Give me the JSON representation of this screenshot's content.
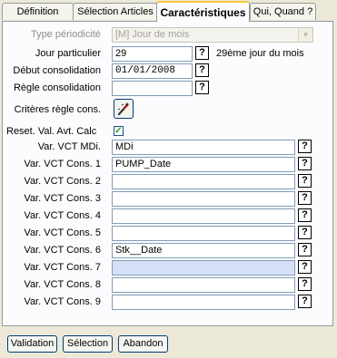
{
  "tabs": [
    {
      "label": "Définition"
    },
    {
      "label": "Sélection Articles"
    },
    {
      "label": "Caractéristiques"
    },
    {
      "label": "Qui, Quand ?"
    }
  ],
  "active_tab": "Caractéristiques",
  "form": {
    "type_periodicite": {
      "label": "Type périodicité",
      "value": "[M] Jour de mois"
    },
    "jour_particulier": {
      "label": "Jour particulier",
      "value": "29",
      "note": "29ème jour du mois"
    },
    "debut_consolidation": {
      "label": "Début consolidation",
      "value": "01/01/2008"
    },
    "regle_consolidation": {
      "label": "Règle consolidation",
      "value": ""
    },
    "criteres_regle": {
      "label": "Critères règle cons."
    },
    "reset_val": {
      "label": "Reset. Val. Avt. Calc",
      "checked": true
    },
    "var_vct": [
      {
        "label": "Var. VCT MDi.",
        "value": "MDi"
      },
      {
        "label": "Var. VCT Cons. 1",
        "value": "PUMP_Date"
      },
      {
        "label": "Var. VCT Cons. 2",
        "value": ""
      },
      {
        "label": "Var. VCT Cons. 3",
        "value": ""
      },
      {
        "label": "Var. VCT Cons. 4",
        "value": ""
      },
      {
        "label": "Var. VCT Cons. 5",
        "value": ""
      },
      {
        "label": "Var. VCT Cons. 6",
        "value": "Stk__Date"
      },
      {
        "label": "Var. VCT Cons. 7",
        "value": ""
      },
      {
        "label": "Var. VCT Cons. 8",
        "value": ""
      },
      {
        "label": "Var. VCT Cons. 9",
        "value": ""
      }
    ]
  },
  "help_glyph": "?",
  "check_glyph": "✓",
  "buttons": {
    "validation": "Validation",
    "selection": "Sélection",
    "abandon": "Abandon"
  },
  "colors": {
    "background": "#ece9d8",
    "panel": "#fcfcfe",
    "active_tab_accent": "#ffc83c",
    "field_border": "#7f9db9",
    "focused_field": "#d8e0f8",
    "checkbox_mark": "#21a121"
  }
}
